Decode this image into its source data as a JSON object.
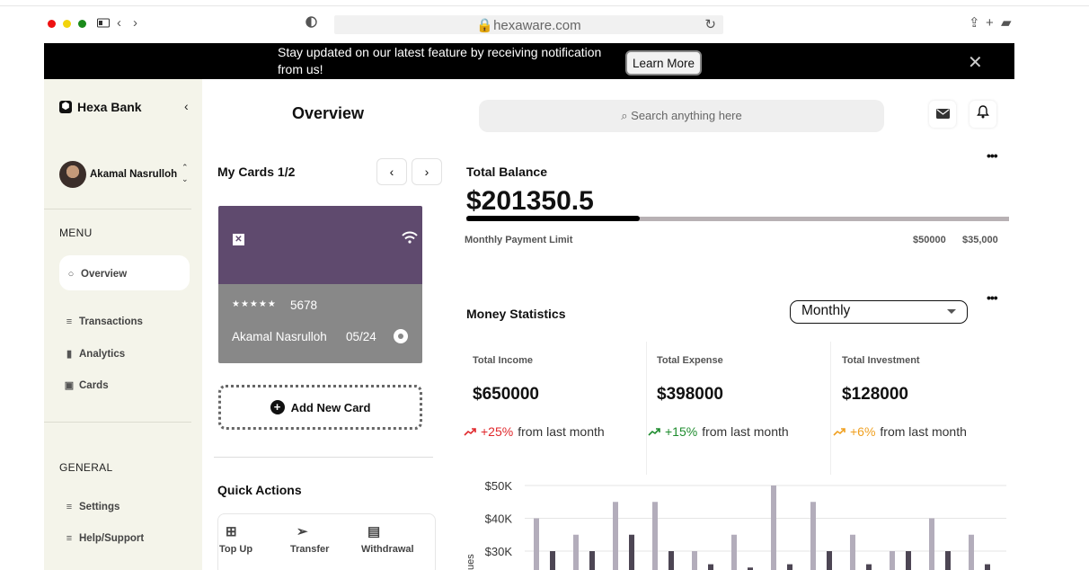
{
  "browser": {
    "url": "hexaware.com"
  },
  "banner": {
    "message": "Stay updated on our latest feature by receiving notification from us!",
    "button": "Learn More"
  },
  "sidebar": {
    "brand": "Hexa Bank",
    "user": "Akamal Nasrulloh",
    "menu_title": "MENU",
    "menu_items": [
      "Overview",
      "Transactions",
      "Analytics",
      "Cards"
    ],
    "general_title": "GENERAL",
    "general_items": [
      "Settings",
      "Help/Support"
    ]
  },
  "header": {
    "title": "Overview",
    "search_placeholder": "Search anything here"
  },
  "cards": {
    "title": "My Cards 1/2",
    "card": {
      "mask": "★★★★★",
      "last4": "5678",
      "holder": "Akamal Nasrulloh",
      "expiry": "05/24"
    },
    "add_card": "Add New Card",
    "quick_actions_title": "Quick Actions",
    "quick_actions": [
      "Top Up",
      "Transfer",
      "Withdrawal"
    ]
  },
  "balance": {
    "title": "Total Balance",
    "amount": "$201350.5",
    "progress": 0.32,
    "limit_label": "Monthly Payment Limit",
    "limit_values": [
      "$50000",
      "$35,000"
    ]
  },
  "stats": {
    "title": "Money Statistics",
    "period": "Monthly",
    "metrics": [
      {
        "label": "Total Income",
        "value": "$650000",
        "change": "+25%",
        "suffix": "from last month",
        "color": "#e0282c"
      },
      {
        "label": "Total Expense",
        "value": "$398000",
        "change": "+15%",
        "suffix": "from last month",
        "color": "#1e8c2e"
      },
      {
        "label": "Total Investment",
        "value": "$128000",
        "change": "+6%",
        "suffix": "from last month",
        "color": "#f0a020"
      }
    ]
  },
  "colors": {
    "sidebar_bg": "#f4f4ea",
    "card_top": "#5f4a6e",
    "card_bottom": "#888888",
    "bar_light": "#b3adbb",
    "bar_dark": "#4d4654"
  },
  "chart_data": {
    "type": "bar",
    "ylabel": "ues",
    "yticks": [
      "$50K",
      "$40K",
      "$30K"
    ],
    "ylim": [
      25000,
      50000
    ],
    "series": [
      {
        "values": [
          40000,
          35000,
          45000,
          45000,
          30000,
          35000,
          50000,
          45000,
          35000,
          30000,
          40000,
          35000
        ]
      },
      {
        "values": [
          30000,
          30000,
          35000,
          30000,
          26000,
          25000,
          26000,
          30000,
          26000,
          30000,
          30000,
          26000
        ]
      }
    ]
  }
}
